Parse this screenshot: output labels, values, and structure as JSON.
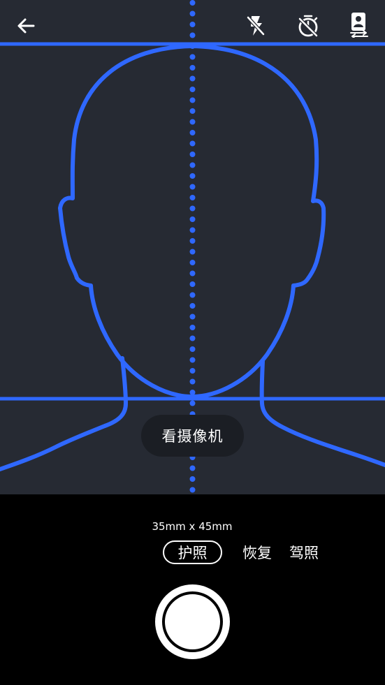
{
  "topbar": {
    "back_icon": "arrow-left-icon",
    "flash_icon": "flash-off-icon",
    "timer_icon": "timer-off-icon",
    "switch_camera_icon": "switch-camera-icon"
  },
  "viewfinder": {
    "hint": "看摄像机",
    "guide_color": "#2f68ff",
    "background": "#262a33"
  },
  "controls": {
    "photo_size": "35mm x 45mm",
    "modes": [
      {
        "label": "护照",
        "active": true
      },
      {
        "label": "恢复",
        "active": false
      },
      {
        "label": "驾照",
        "active": false
      }
    ],
    "shutter_icon": "shutter-button"
  }
}
